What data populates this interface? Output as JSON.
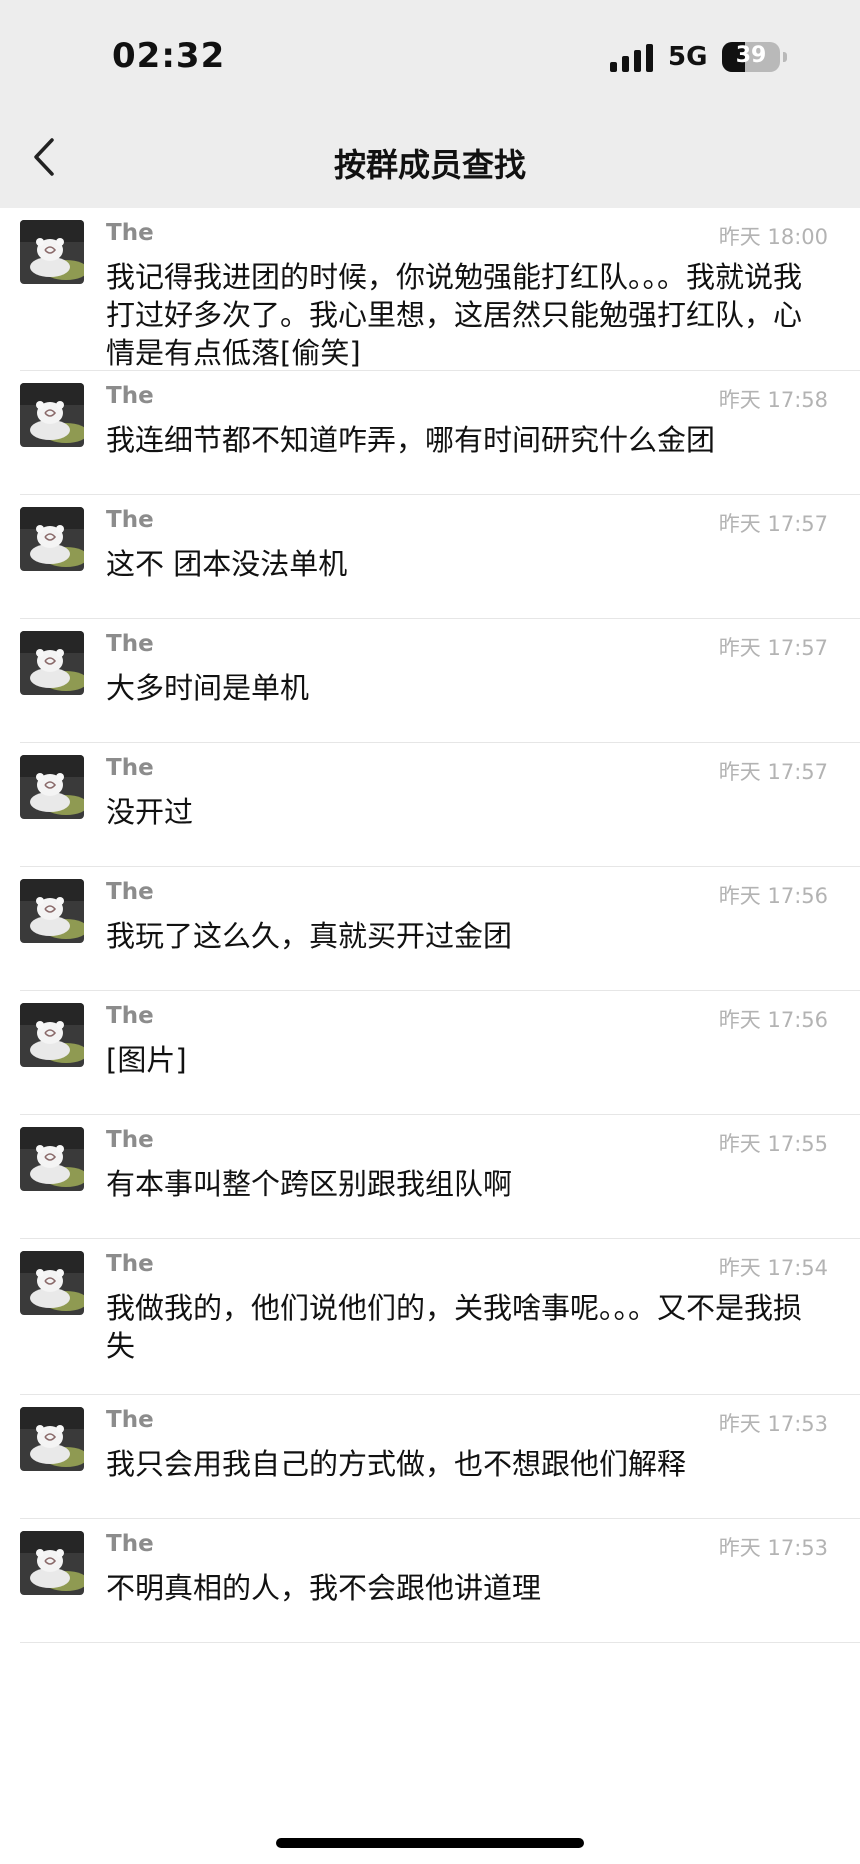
{
  "status_bar": {
    "time": "02:32",
    "network": "5G",
    "battery_level": "39",
    "battery_fraction": 0.39
  },
  "nav": {
    "title": "按群成员查找",
    "back_icon": "chevron-left-icon"
  },
  "messages": [
    {
      "sender": "The",
      "time": "昨天 18:00",
      "text": "我记得我进团的时候，你说勉强能打红队。。。我就说我打过好多次了。我心里想，这居然只能勉强打红队，心情是有点低落[偷笑]"
    },
    {
      "sender": "The",
      "time": "昨天 17:58",
      "text": "我连细节都不知道咋弄，哪有时间研究什么金团"
    },
    {
      "sender": "The",
      "time": "昨天 17:57",
      "text": "这不 团本没法单机"
    },
    {
      "sender": "The",
      "time": "昨天 17:57",
      "text": "大多时间是单机"
    },
    {
      "sender": "The",
      "time": "昨天 17:57",
      "text": "没开过"
    },
    {
      "sender": "The",
      "time": "昨天 17:56",
      "text": "我玩了这么久，真就买开过金团"
    },
    {
      "sender": "The",
      "time": "昨天 17:56",
      "text": "[图片]"
    },
    {
      "sender": "The",
      "time": "昨天 17:55",
      "text": "有本事叫整个跨区别跟我组队啊"
    },
    {
      "sender": "The",
      "time": "昨天 17:54",
      "text": "我做我的，他们说他们的，关我啥事呢。。。又不是我损失"
    },
    {
      "sender": "The",
      "time": "昨天 17:53",
      "text": "我只会用我自己的方式做，也不想跟他们解释"
    },
    {
      "sender": "The",
      "time": "昨天 17:53",
      "text": "不明真相的人，我不会跟他讲道理"
    }
  ]
}
